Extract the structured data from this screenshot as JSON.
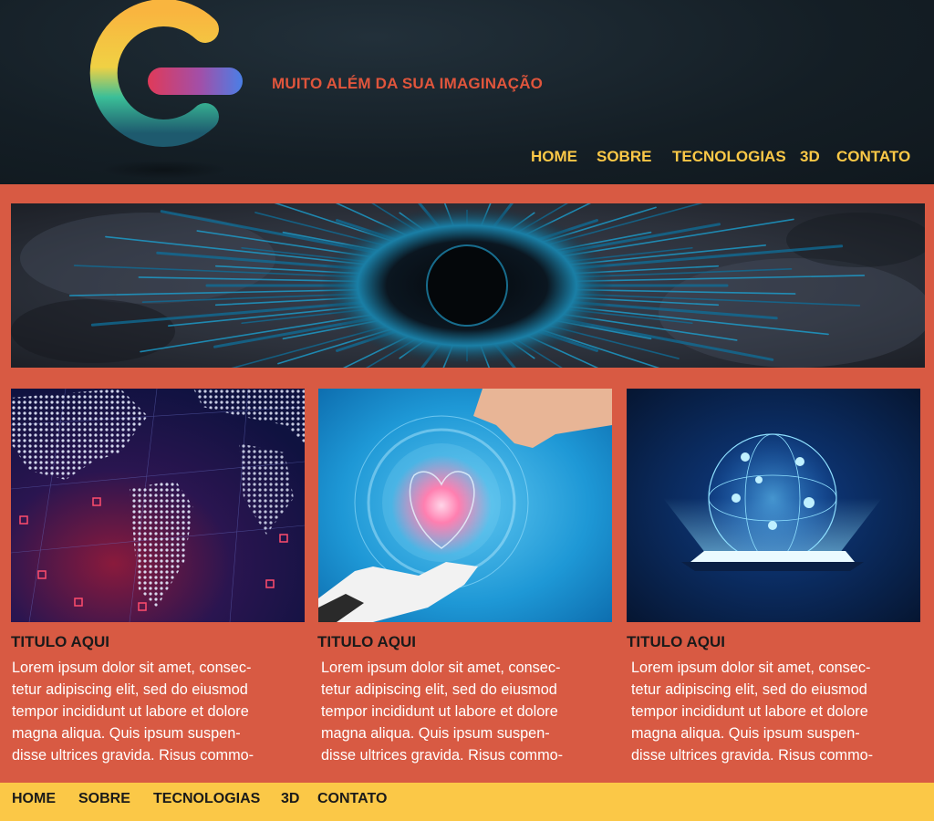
{
  "header": {
    "tagline": "MUITO ALÉM DA SUA IMAGINAÇÃO",
    "nav": [
      "HOME",
      "SOBRE",
      "TECNOLOGIAS",
      "3D",
      "CONTATO"
    ]
  },
  "cards": [
    {
      "title": "TITULO AQUI",
      "text_lines": [
        "Lorem ipsum dolor sit amet, consec-",
        "tetur adipiscing elit, sed do eiusmod",
        "tempor incididunt ut labore et dolore",
        "magna aliqua. Quis ipsum suspen-",
        "disse ultrices gravida. Risus commo-"
      ]
    },
    {
      "title": "TITULO AQUI",
      "text_lines": [
        "Lorem ipsum dolor sit amet, consec-",
        "tetur adipiscing elit, sed do eiusmod",
        "tempor incididunt ut labore et dolore",
        "magna aliqua. Quis ipsum suspen-",
        "disse ultrices gravida. Risus commo-"
      ]
    },
    {
      "title": "TITULO AQUI",
      "text_lines": [
        "Lorem ipsum dolor sit amet, consec-",
        "tetur adipiscing elit, sed do eiusmod",
        "tempor incididunt ut labore et dolore",
        "magna aliqua. Quis ipsum suspen-",
        "disse ultrices gravida. Risus commo-"
      ]
    }
  ],
  "footer": {
    "nav": [
      "HOME",
      "SOBRE",
      "TECNOLOGIAS",
      "3D",
      "CONTATO"
    ]
  },
  "colors": {
    "header_bg": "#141e25",
    "page_bg": "#d85a43",
    "accent_yellow": "#fbc847",
    "tagline": "#e0553c"
  },
  "icons": [
    "g-logo",
    "digital-world-map-image",
    "hologram-heart-robot-hand-image",
    "tablet-hologram-globe-image",
    "abstract-flower-banner-image"
  ]
}
